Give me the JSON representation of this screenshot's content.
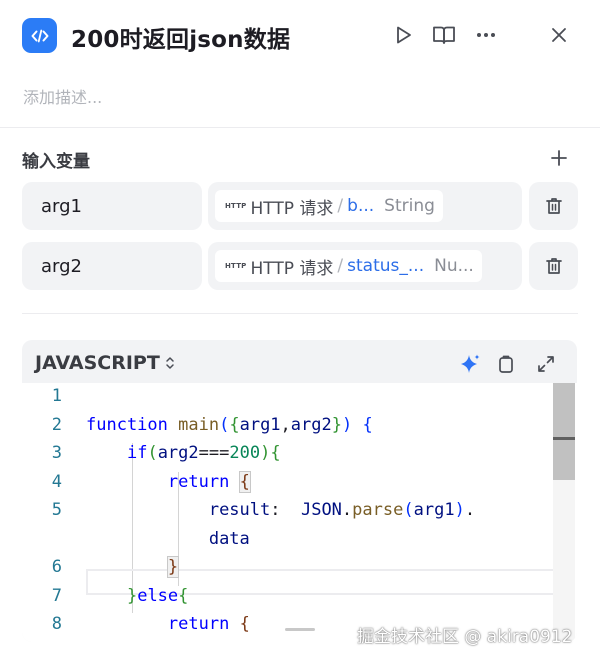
{
  "header": {
    "title": "200时返回json数据",
    "description_placeholder": "添加描述..."
  },
  "inputs": {
    "section_title": "输入变量",
    "variables": [
      {
        "name": "arg1",
        "badge": "HTTP",
        "source": "HTTP 请求",
        "separator": "/",
        "field": "b...",
        "type": "String"
      },
      {
        "name": "arg2",
        "badge": "HTTP",
        "source": "HTTP 请求",
        "separator": "/",
        "field": "status_...",
        "type": "Nu..."
      }
    ]
  },
  "code": {
    "language": "JAVASCRIPT",
    "line_numbers": [
      "1",
      "2",
      "3",
      "4",
      "5",
      "6",
      "7",
      "8"
    ]
  },
  "watermark": "掘金技术社区 @ akira0912",
  "icons": {
    "node": "code-icon",
    "run": "play-icon",
    "docs": "book-icon",
    "more": "more-icon",
    "close": "close-icon",
    "add": "plus-icon",
    "delete": "trash-icon",
    "ai": "sparkle-icon",
    "copy": "copy-icon",
    "expand": "expand-icon"
  },
  "colors": {
    "accent": "#2b7cf6",
    "field_link": "#2d6ee8",
    "ai_icon": "#2f74f5"
  }
}
